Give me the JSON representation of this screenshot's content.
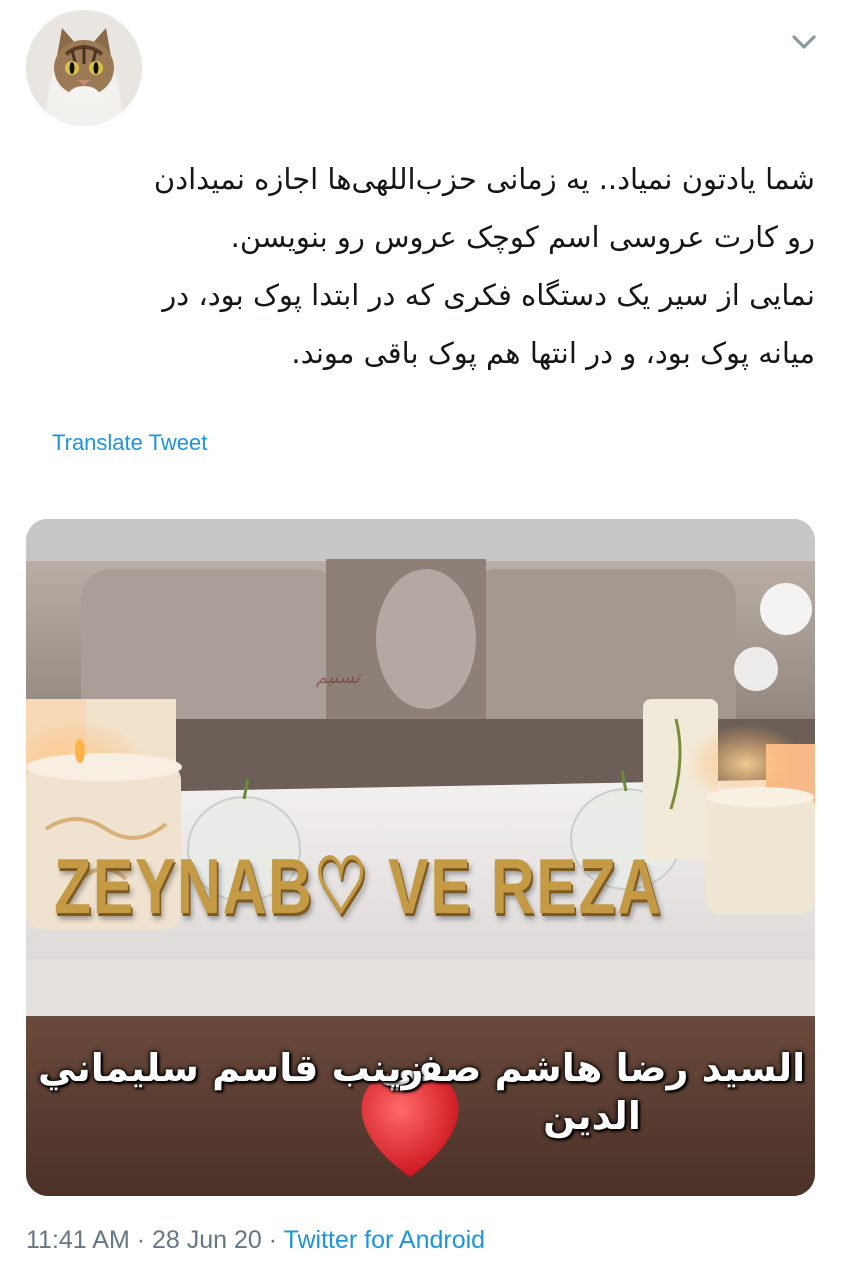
{
  "header": {
    "avatar_icon": "cat-avatar",
    "menu_icon": "chevron-down-icon"
  },
  "tweet": {
    "lines": [
      "شما یادتون نمیاد.. یه زمانی حزب‌اللهی‌ها اجازه نمیدادن",
      "رو کارت عروسی اسم کوچک عروس رو بنویسن.",
      "نمایی از سیر یک دستگاه فکری که در ابتدا پوک بود، در",
      "میانه پوک بود، و در انتها هم پوک باقی موند."
    ],
    "translate_label": "Translate Tweet"
  },
  "media": {
    "letters": "ZEYNAB♡ VE REZA",
    "caption_groom": "السيد رضا هاشم صفي الدين",
    "caption_bride": "زينب قاسم سليماني",
    "watermark": "تسنیم",
    "heart_icon": "heart-icon"
  },
  "meta": {
    "time": "11:41 AM",
    "separator1": " · ",
    "date": "28 Jun 20",
    "separator2": " · ",
    "source": "Twitter for Android"
  },
  "colors": {
    "link": "#1b95e0",
    "meta_text": "#657786",
    "text": "#14171a"
  }
}
